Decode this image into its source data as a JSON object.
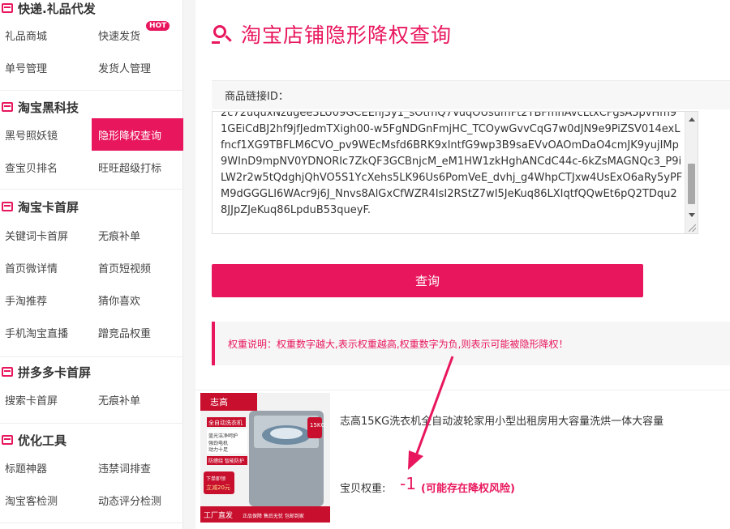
{
  "sidebar": {
    "sections": [
      {
        "title": "快递.礼品代发",
        "items": [
          [
            "礼品商城",
            "快速发货"
          ],
          [
            "单号管理",
            "发货人管理"
          ]
        ]
      },
      {
        "title": "淘宝黑科技",
        "items": [
          [
            "黑号照妖镜",
            "隐形降权查询"
          ],
          [
            "查宝贝排名",
            "旺旺超级打标"
          ]
        ]
      },
      {
        "title": "淘宝卡首屏",
        "items": [
          [
            "关键词卡首屏",
            "无痕补单"
          ],
          [
            "首页微详情",
            "首页短视频"
          ],
          [
            "手淘推荐",
            "猜你喜欢"
          ],
          [
            "手机淘宝直播",
            "蹭竞品权重"
          ]
        ]
      },
      {
        "title": "拼多多卡首屏",
        "items": [
          [
            "搜索卡首屏",
            "无痕补单"
          ]
        ]
      },
      {
        "title": "优化工具",
        "items": [
          [
            "标题神器",
            "违禁词排查"
          ],
          [
            "淘宝客检测",
            "动态评分检测"
          ]
        ]
      }
    ],
    "hot_badge": "HOT",
    "active_item": "隐形降权查询"
  },
  "main": {
    "title": "淘宝店铺隐形降权查询",
    "field_label": "商品链接ID：",
    "textarea_value": "2c72uquxNzugee3LU09GCEEhj3y1_sOtmQ7VuqOUsumFt2TBFmnAvcLtxCFgsA5pvHm91GEiCdBJ2hf9jfJedmTXigh00-w5FgNDGnFmjHC_TCOywGvvCqG7w0dJN9e9PiZSV014exLfncf1XG9TBFLM6CVO_pv9WEcMsfd6BRK9xIntfG9wp3B9saEVvOAOmDaO4cmJK9yujIMp9WInD9mpNV0YDNORIc7ZkQF3GCBnjcM_eM1HW1zkHghANCdC44c-6kZsMAGNQc3_P9iLW2r2w5tQdghjQhVO5S1YcXehs5LK96Us6PomVeE_dvhj_g4WhpCTJxw4UsExO6aRy5yPFM9dGGGLI6WAcr9j6J_Nnvs8AlGxCfWZR4IsI2RStZ7wI5JeKuq86LXIqtfQQwEt6pQ2TDqu28JJpZJeKuq86LpduB53queyF.",
    "query_button": "查询",
    "notice": "权重说明：权重数字越大,表示权重越高,权重数字为负,则表示可能被隐形降权！",
    "result": {
      "product_title": "志高15KG洗衣机全自动波轮家用小型出租房用大容量洗烘一体大容量",
      "weight_label": "宝贝权重:",
      "weight_value": "-1",
      "weight_note": "(可能存在降权风险)"
    },
    "product_image_text": {
      "brand": "志高",
      "capacity": "15KG",
      "tag1": "全自动洗衣机",
      "tag2": "蓝光洁净呵护 强劲电机 动力十足",
      "tag3": "防缠绕 智能防护",
      "promo": "下单即领 立减20元",
      "footer_left": "工厂直发",
      "footer_right": "正品保障 售后无忧 包邮到家"
    }
  },
  "colors": {
    "accent": "#e8175d"
  }
}
